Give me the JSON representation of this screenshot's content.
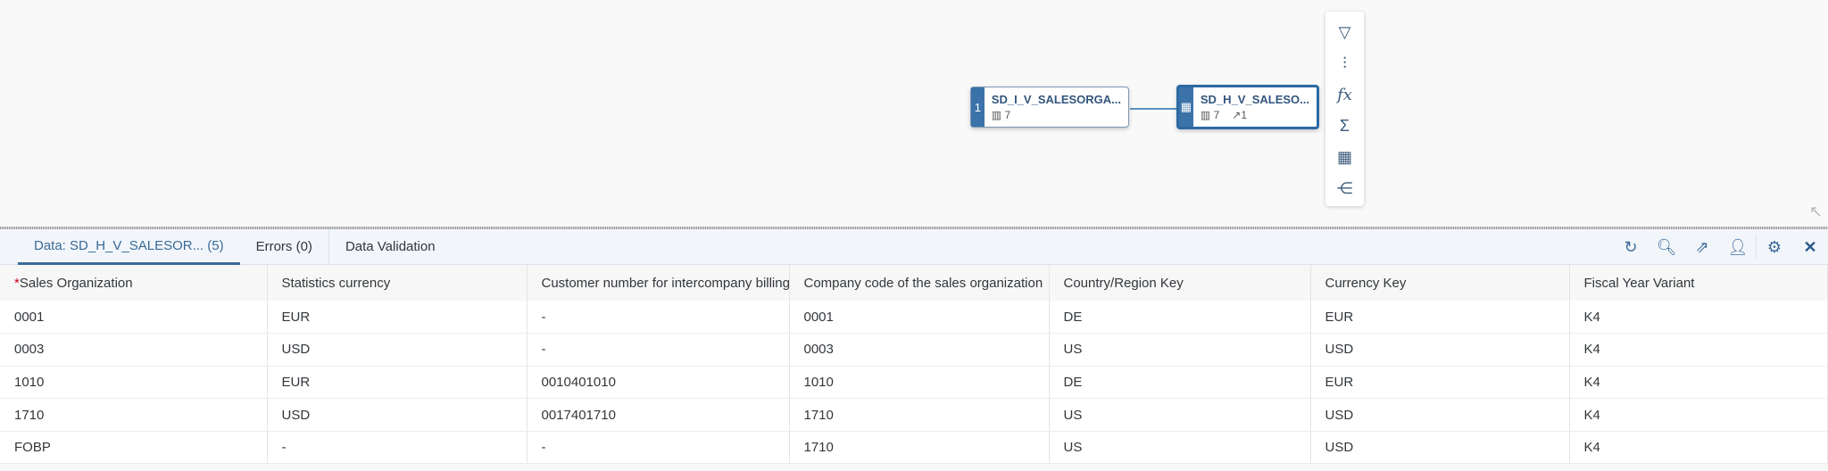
{
  "graph": {
    "source_node": {
      "index": "1",
      "name": "SD_I_V_SALESORGA...",
      "columns": "7"
    },
    "target_node": {
      "name": "SD_H_V_SALESO...",
      "columns": "7",
      "joins": "1"
    },
    "toolbar": [
      "filter-icon",
      "adjust-icon",
      "formula-icon",
      "sum-icon",
      "table-icon",
      "hierarchy-icon"
    ]
  },
  "tabs": [
    {
      "label": "Data: SD_H_V_SALESOR... (5)",
      "active": true
    },
    {
      "label": "Errors (0)"
    },
    {
      "label": "Data Validation"
    }
  ],
  "table": {
    "columns": [
      "Sales Organization",
      "Statistics currency",
      "Customer number for intercompany billing",
      "Company code of the sales organization",
      "Country/Region Key",
      "Currency Key",
      "Fiscal Year Variant"
    ],
    "required_marker": "*",
    "rows": [
      [
        "0001",
        "EUR",
        "-",
        "0001",
        "DE",
        "EUR",
        "K4"
      ],
      [
        "0003",
        "USD",
        "-",
        "0003",
        "US",
        "USD",
        "K4"
      ],
      [
        "1010",
        "EUR",
        "0010401010",
        "1010",
        "DE",
        "EUR",
        "K4"
      ],
      [
        "1710",
        "USD",
        "0017401710",
        "1710",
        "US",
        "USD",
        "K4"
      ],
      [
        "FOBP",
        "-",
        "-",
        "1710",
        "US",
        "USD",
        "K4"
      ]
    ]
  },
  "accent": "#3a6a99"
}
